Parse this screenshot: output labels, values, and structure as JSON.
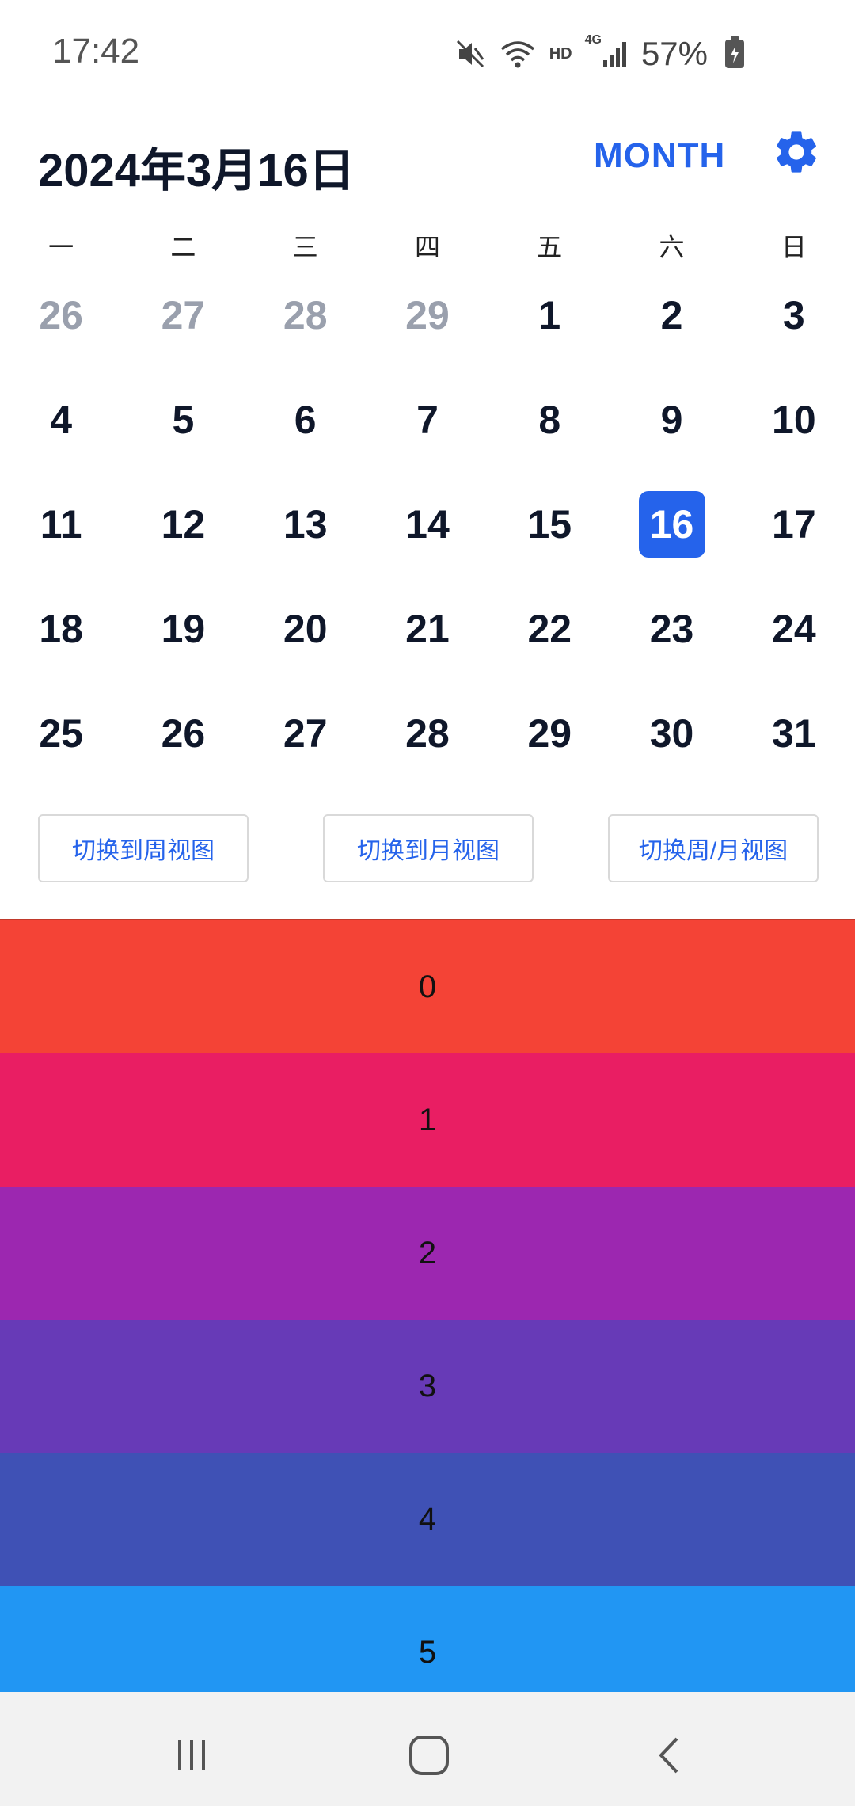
{
  "status_bar": {
    "time": "17:42",
    "network_label": "HD",
    "signal_label": "4G",
    "battery": "57%",
    "icons": [
      "mute-icon",
      "wifi-icon",
      "signal-icon",
      "battery-charging-icon"
    ]
  },
  "header": {
    "title": "2024年3月16日",
    "mode_label": "MONTH",
    "settings_icon": "gear-icon",
    "accent_color": "#2563eb"
  },
  "weekdays": [
    "一",
    "二",
    "三",
    "四",
    "五",
    "六",
    "日"
  ],
  "calendar": {
    "rows": [
      [
        "26",
        "27",
        "28",
        "29",
        "1",
        "2",
        "3"
      ],
      [
        "4",
        "5",
        "6",
        "7",
        "8",
        "9",
        "10"
      ],
      [
        "11",
        "12",
        "13",
        "14",
        "15",
        "16",
        "17"
      ],
      [
        "18",
        "19",
        "20",
        "21",
        "22",
        "23",
        "24"
      ],
      [
        "25",
        "26",
        "27",
        "28",
        "29",
        "30",
        "31"
      ]
    ],
    "other_month_cells": [
      [
        0,
        0
      ],
      [
        0,
        1
      ],
      [
        0,
        2
      ],
      [
        0,
        3
      ]
    ],
    "selected_cell": [
      2,
      5
    ]
  },
  "view_buttons": {
    "week": "切换到周视图",
    "month": "切换到月视图",
    "toggle": "切换周/月视图"
  },
  "list": {
    "items": [
      {
        "label": "0",
        "color": "#f44336"
      },
      {
        "label": "1",
        "color": "#e91e63"
      },
      {
        "label": "2",
        "color": "#9c27b0"
      },
      {
        "label": "3",
        "color": "#673ab7"
      },
      {
        "label": "4",
        "color": "#3f51b5"
      },
      {
        "label": "5",
        "color": "#2196f3"
      }
    ]
  },
  "nav_bar": {
    "icons": [
      "recent-apps-icon",
      "home-icon",
      "back-icon"
    ]
  }
}
